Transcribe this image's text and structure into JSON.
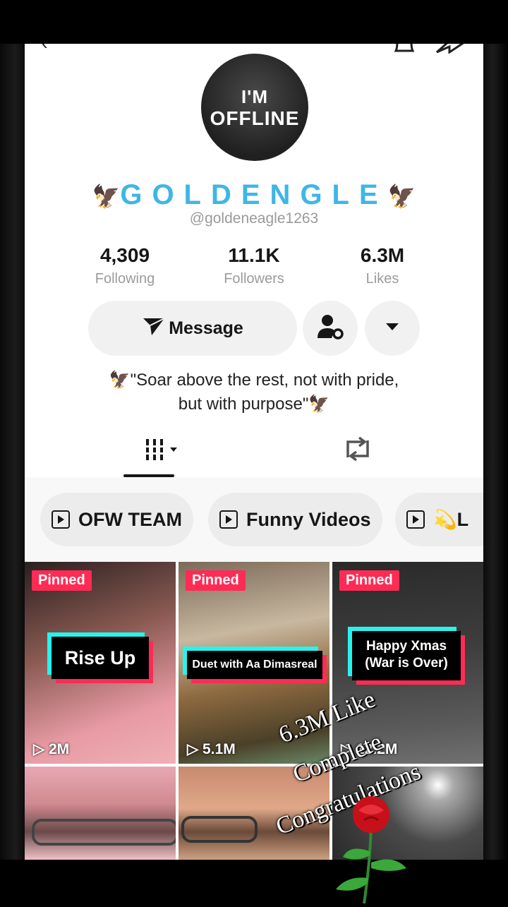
{
  "profile": {
    "avatar_line1": "I'M",
    "avatar_line2": "OFFLINE",
    "display_name": "GOLDENGLE",
    "eagle_left": "🦅",
    "eagle_right": "🦅",
    "handle": "@goldeneagle1263",
    "stats": [
      {
        "value": "4,309",
        "label": "Following"
      },
      {
        "value": "11.1K",
        "label": "Followers"
      },
      {
        "value": "6.3M",
        "label": "Likes"
      }
    ],
    "message_button": "Message",
    "bio_line1": "🦅\"Soar above the rest, not with pride,",
    "bio_line2": "but with purpose\"🦅"
  },
  "playlists": [
    {
      "label": "OFW TEAM"
    },
    {
      "label": "Funny Videos"
    },
    {
      "label": "💫L"
    }
  ],
  "videos": [
    {
      "pinned": "Pinned",
      "title": "Rise Up",
      "views": "2M"
    },
    {
      "pinned": "Pinned",
      "title": "Duet with Aa Dimasreal",
      "views": "5.1M"
    },
    {
      "pinned": "Pinned",
      "title_line1": "Happy Xmas",
      "title_line2": "(War is Over)",
      "views": "12.2M"
    }
  ],
  "overlay": {
    "line1": "6.3M Like",
    "line2": "Complete",
    "line3": "Congratulations"
  },
  "icons": [
    "back-icon",
    "bell-icon",
    "share-icon",
    "paper-plane-icon",
    "user-settings-icon",
    "dropdown-arrow-icon",
    "grid-icon",
    "repost-icon",
    "playlist-icon",
    "play-icon",
    "rose-icon"
  ],
  "colors": {
    "accent_cyan": "#25f4ee",
    "accent_red": "#fe2c55",
    "name_blue": "#3fb6e6"
  }
}
